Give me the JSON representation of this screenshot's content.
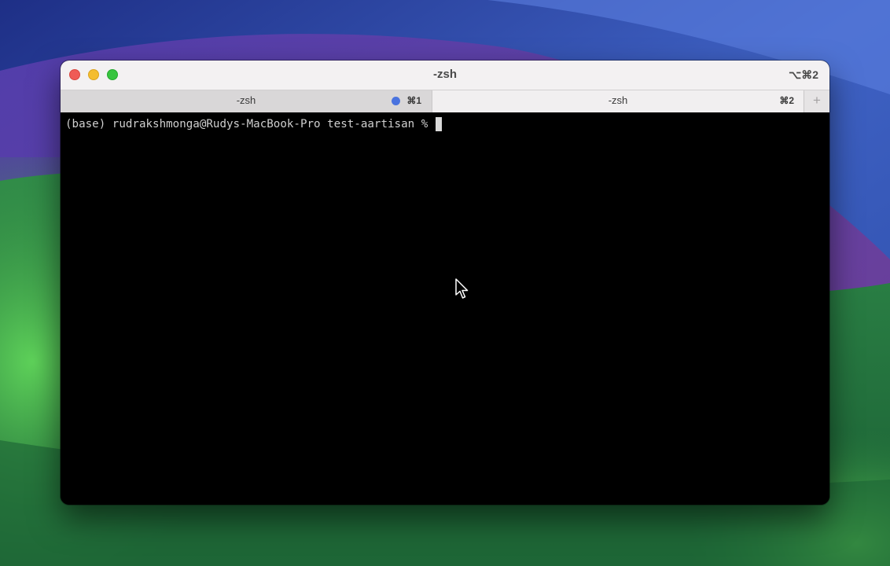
{
  "window": {
    "title": "-zsh",
    "shortcut": "⌥⌘2"
  },
  "tabs": [
    {
      "label": "-zsh",
      "shortcut": "⌘1",
      "active": false,
      "has_activity": true
    },
    {
      "label": "-zsh",
      "shortcut": "⌘2",
      "active": true,
      "has_activity": false
    }
  ],
  "new_tab": {
    "label": "+"
  },
  "terminal": {
    "prompt": "(base) rudrakshmonga@Rudys-MacBook-Pro test-aartisan % "
  },
  "icons": {
    "close": "close-icon",
    "minimize": "minimize-icon",
    "maximize": "maximize-icon",
    "pointer": "mouse-pointer-icon",
    "activity": "activity-dot-icon"
  },
  "colors": {
    "terminal_bg": "#000000",
    "terminal_fg": "#cfcfcf",
    "activity_dot": "#4a73df",
    "close": "#ef5b56",
    "minimize": "#f4bd2f",
    "maximize": "#37c43f"
  }
}
